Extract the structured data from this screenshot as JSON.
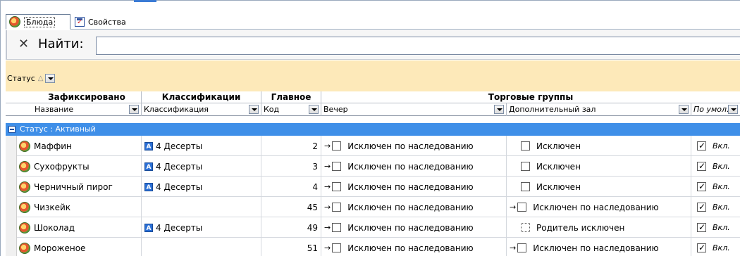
{
  "tabs": [
    {
      "label": "Блюда",
      "icon": "dish-icon"
    },
    {
      "label": "Свойства",
      "icon": "properties-icon"
    }
  ],
  "search": {
    "label": "Найти:",
    "value": ""
  },
  "group_panel": {
    "chip": "Статус"
  },
  "bands": {
    "fixed": "Зафиксировано",
    "class": "Классификации",
    "main": "Главное",
    "trade": "Торговые группы"
  },
  "columns": {
    "name": "Название",
    "class": "Классификация",
    "code": "Код",
    "evening": "Вечер",
    "hall": "Дополнительный зал",
    "default": "По умол."
  },
  "group_row": "Статус : Активный",
  "rows": [
    {
      "name": "Маффин",
      "class": "4 Десерты",
      "code": "2",
      "evening": "Исключен по наследованию",
      "hall": "Исключен",
      "default": "Вкл."
    },
    {
      "name": "Сухофрукты",
      "class": "4 Десерты",
      "code": "3",
      "evening": "Исключен по наследованию",
      "hall": "Исключен",
      "default": "Вкл."
    },
    {
      "name": "Черничный пирог",
      "class": "4 Десерты",
      "code": "4",
      "evening": "Исключен по наследованию",
      "hall": "Исключен",
      "default": "Вкл."
    },
    {
      "name": "Чизкейк",
      "class": "",
      "code": "45",
      "evening": "Исключен по наследованию",
      "hall": "Исключен по наследованию",
      "default": "Вкл."
    },
    {
      "name": "Шоколад",
      "class": "4 Десерты",
      "code": "49",
      "evening": "Исключен по наследованию",
      "hall": "Родитель исключен",
      "default": "Вкл."
    },
    {
      "name": "Мороженое",
      "class": "",
      "code": "51",
      "evening": "Исключен по наследованию",
      "hall": "Исключен по наследованию",
      "default": "Вкл."
    }
  ]
}
